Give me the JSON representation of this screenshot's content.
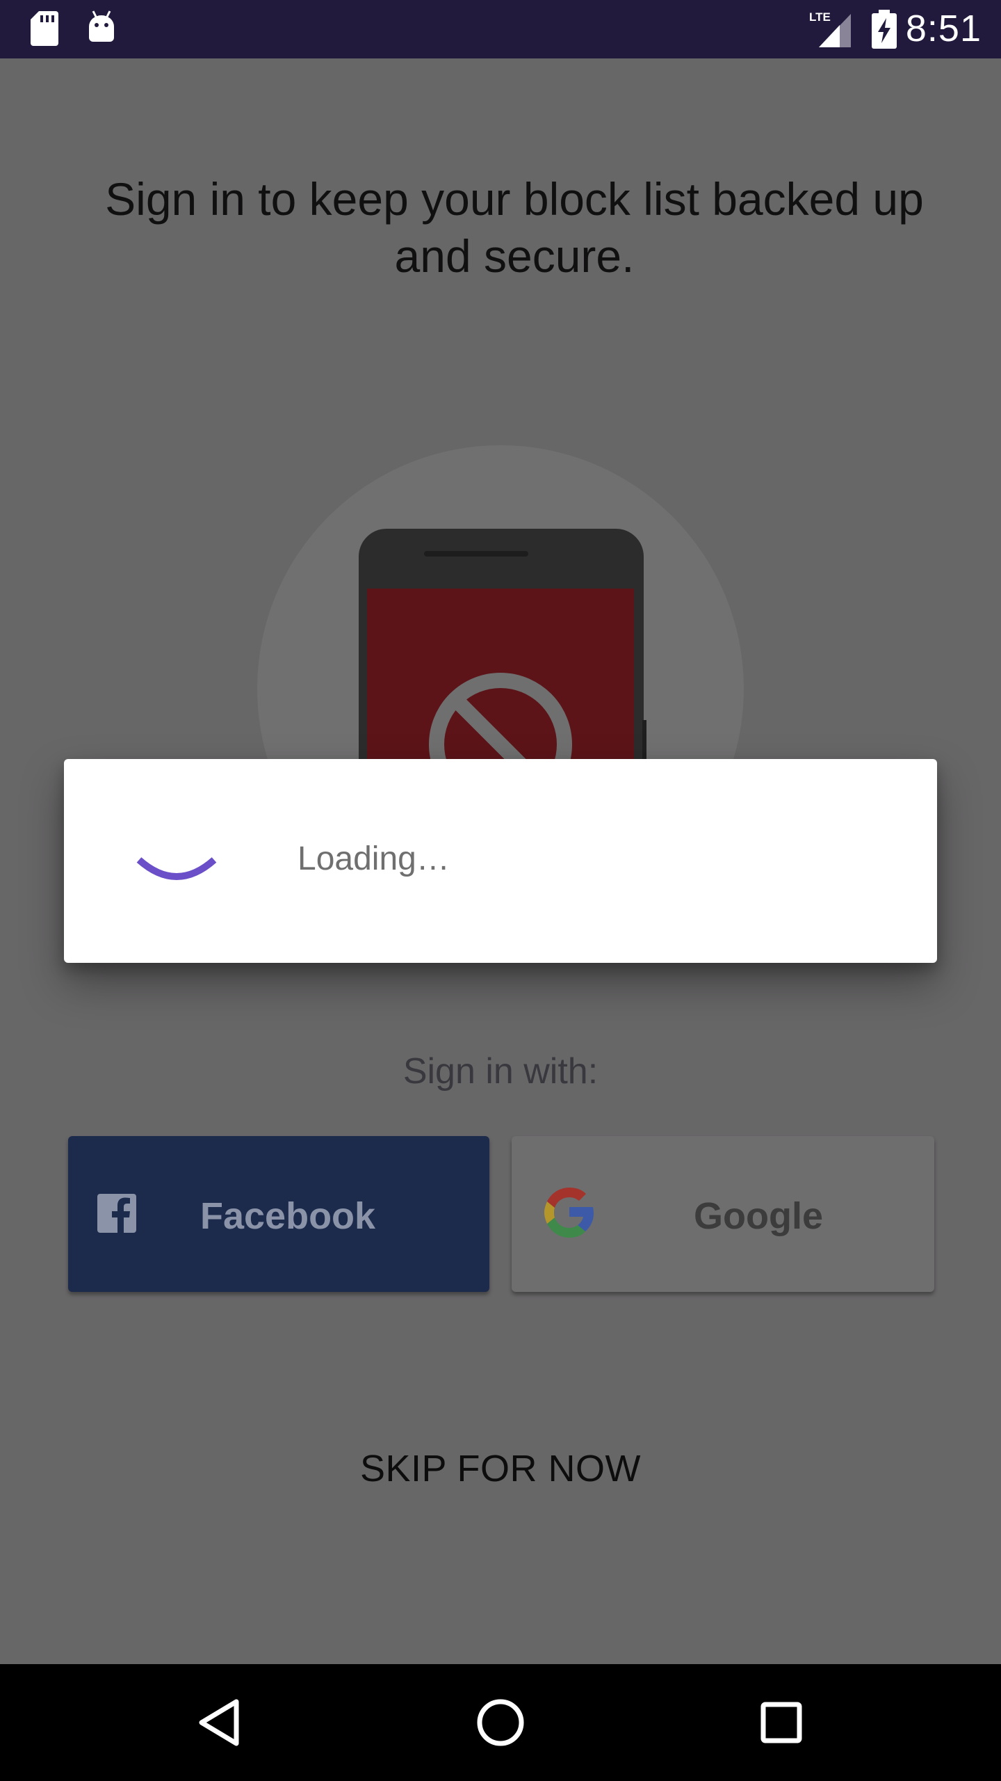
{
  "status_bar": {
    "time": "8:51",
    "network": "LTE",
    "icons": [
      "sd-card-icon",
      "android-icon",
      "lte-signal-icon",
      "battery-charging-icon"
    ]
  },
  "main": {
    "headline": "Sign in to keep your block list backed up and secure.",
    "illustration": "blocked-phone-icon",
    "sign_in_with_label": "Sign in with:",
    "facebook_label": "Facebook",
    "google_label": "Google",
    "skip_label": "SKIP FOR NOW"
  },
  "dialog": {
    "loading_text": "Loading…",
    "spinner_color": "#6b4fc8"
  },
  "nav_bar": {
    "icons": [
      "back-icon",
      "home-icon",
      "recents-icon"
    ]
  },
  "colors": {
    "status_bar": "#221a3d",
    "scrim_background": "#686768",
    "facebook": "#1c2a4c",
    "google_button": "#6e6e6e",
    "block_red": "#5c1418"
  }
}
